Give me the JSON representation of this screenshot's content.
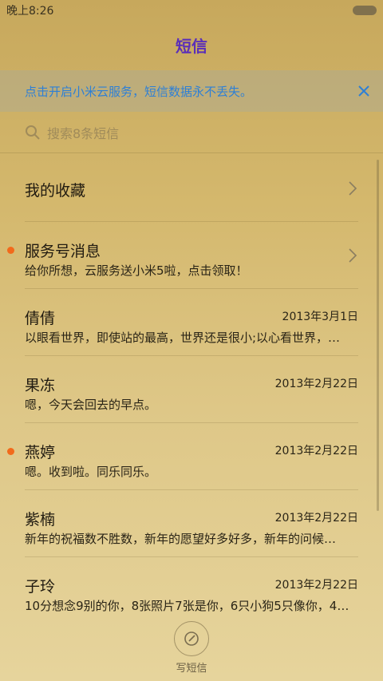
{
  "status_bar": {
    "time": "晚上8:26"
  },
  "header": {
    "title": "短信"
  },
  "banner": {
    "text": "点击开启小米云服务，短信数据永不丢失。"
  },
  "search": {
    "placeholder": "搜索8条短信"
  },
  "favorites": {
    "label": "我的收藏"
  },
  "service": {
    "title": "服务号消息",
    "preview": "给你所想，云服务送小米5啦，点击领取！",
    "unread": true
  },
  "conversations": [
    {
      "name": "倩倩",
      "date": "2013年3月1日",
      "preview": "以眼看世界，即使站的最高，世界还是很小;以心看世界，…",
      "unread": false
    },
    {
      "name": "果冻",
      "date": "2013年2月22日",
      "preview": "嗯，今天会回去的早点。",
      "unread": false
    },
    {
      "name": "燕婷",
      "date": "2013年2月22日",
      "preview": "嗯。收到啦。同乐同乐。",
      "unread": true
    },
    {
      "name": "紫楠",
      "date": "2013年2月22日",
      "preview": "新年的祝福数不胜数，新年的愿望好多好多，新年的问候…",
      "unread": false
    },
    {
      "name": "子玲",
      "date": "2013年2月22日",
      "preview": "10分想念9别的你，8张照片7张是你，6只小狗5只像你，4…",
      "unread": false
    }
  ],
  "compose": {
    "label": "写短信"
  },
  "colors": {
    "accent": "#5b2fb8",
    "link": "#2d7fd6",
    "unread": "#f26a1b"
  }
}
